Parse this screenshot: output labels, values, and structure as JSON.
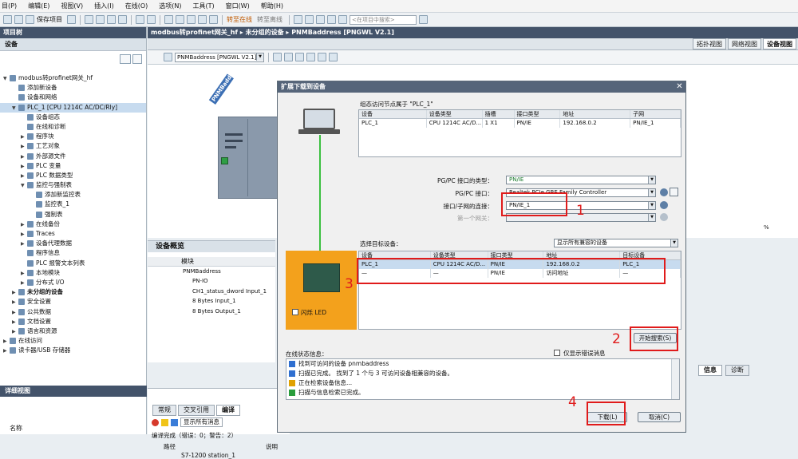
{
  "menu": [
    "目(P)",
    "编辑(E)",
    "视图(V)",
    "插入(I)",
    "在线(O)",
    "选项(N)",
    "工具(T)",
    "窗口(W)",
    "帮助(H)"
  ],
  "toolbar": {
    "save_project": "保存项目",
    "go_online": "转至在线",
    "go_offline": "转至离线",
    "search_placeholder": "<在项目中搜索>"
  },
  "project_tree": {
    "title": "项目树",
    "tab": "设备",
    "items": [
      {
        "label": "modbus转profinet网关_hf",
        "level": 0,
        "tw": "▼"
      },
      {
        "label": "添加新设备",
        "level": 1,
        "tw": ""
      },
      {
        "label": "设备和网络",
        "level": 1,
        "tw": ""
      },
      {
        "label": "PLC_1 [CPU 1214C AC/DC/Rly]",
        "level": 1,
        "tw": "▼",
        "selected": true
      },
      {
        "label": "设备组态",
        "level": 2,
        "tw": ""
      },
      {
        "label": "在线和诊断",
        "level": 2,
        "tw": ""
      },
      {
        "label": "程序块",
        "level": 2,
        "tw": "▶"
      },
      {
        "label": "工艺对象",
        "level": 2,
        "tw": "▶"
      },
      {
        "label": "外部源文件",
        "level": 2,
        "tw": "▶"
      },
      {
        "label": "PLC 变量",
        "level": 2,
        "tw": "▶"
      },
      {
        "label": "PLC 数据类型",
        "level": 2,
        "tw": "▶"
      },
      {
        "label": "监控与强制表",
        "level": 2,
        "tw": "▼"
      },
      {
        "label": "添加新监控表",
        "level": 3,
        "tw": ""
      },
      {
        "label": "监控表_1",
        "level": 3,
        "tw": ""
      },
      {
        "label": "强制表",
        "level": 3,
        "tw": ""
      },
      {
        "label": "在线备份",
        "level": 2,
        "tw": "▶"
      },
      {
        "label": "Traces",
        "level": 2,
        "tw": "▶"
      },
      {
        "label": "设备代理数据",
        "level": 2,
        "tw": "▶"
      },
      {
        "label": "程序信息",
        "level": 2,
        "tw": ""
      },
      {
        "label": "PLC 报警文本列表",
        "level": 2,
        "tw": ""
      },
      {
        "label": "本地模块",
        "level": 2,
        "tw": "▶"
      },
      {
        "label": "分布式 I/O",
        "level": 2,
        "tw": "▶"
      },
      {
        "label": "未分组的设备",
        "level": 1,
        "tw": "▶",
        "bold": true
      },
      {
        "label": "安全设置",
        "level": 1,
        "tw": "▶"
      },
      {
        "label": "公共数据",
        "level": 1,
        "tw": "▶"
      },
      {
        "label": "文档设置",
        "level": 1,
        "tw": "▶"
      },
      {
        "label": "语言和资源",
        "level": 1,
        "tw": "▶"
      },
      {
        "label": "在线访问",
        "level": 0,
        "tw": "▶"
      },
      {
        "label": "读卡器/USB 存储器",
        "level": 0,
        "tw": "▶"
      }
    ],
    "detail_view": "详细视图",
    "detail_col": "名称"
  },
  "breadcrumb": [
    "modbus转profinet网关_hf",
    "未分组的设备",
    "PNMBaddress [PNGWL V2.1]"
  ],
  "view_tabs": [
    "拓扑视图",
    "网络视图",
    "设备视图"
  ],
  "device_combo": "PNMBaddress [PNGWL V2.1]",
  "device_label": "PNMBaddress",
  "zoom_value": "%",
  "device_overview": {
    "title": "设备概览",
    "col_module": "模块",
    "rows": [
      "PNMBaddress",
      "PN-IO",
      "CH1_status_dword Input_1",
      "8 Bytes Input_1",
      "8 Bytes Output_1"
    ]
  },
  "bottom_panel": {
    "tabs": [
      "常规",
      "交叉引用",
      "编译"
    ],
    "filter_label": "显示所有消息",
    "status": "编译完成（错误：0；警告：2）",
    "col_path": "路径",
    "col_desc": "说明",
    "row1": "S7-1200 station_1"
  },
  "info_tabs": [
    "信息",
    "诊断"
  ],
  "dialog": {
    "title": "扩展下载到设备",
    "node_label": "组态访问节点属于 \"PLC_1\"",
    "config_headers": [
      "设备",
      "设备类型",
      "插槽",
      "接口类型",
      "地址",
      "子网"
    ],
    "config_row": [
      "PLC_1",
      "CPU 1214C AC/D...",
      "1 X1",
      "PN/IE",
      "192.168.0.2",
      "PN/IE_1"
    ],
    "pgpc_type_label": "PG/PC 接口的类型：",
    "pgpc_type_value": "PN/IE",
    "pgpc_iface_label": "PG/PC 接口：",
    "pgpc_iface_value": "Realtek PCIe GBE Family Controller",
    "subnet_label": "接口/子网的连接：",
    "subnet_value": "PN/IE_1",
    "gateway_label": "第一个网关：",
    "target_label": "选择目标设备：",
    "target_filter": "显示所有兼容的设备",
    "target_headers": [
      "设备",
      "设备类型",
      "接口类型",
      "地址",
      "目标设备"
    ],
    "target_rows": [
      [
        "PLC_1",
        "CPU 1214C AC/D...",
        "PN/IE",
        "192.168.0.2",
        "PLC_1"
      ],
      [
        "—",
        "—",
        "PN/IE",
        "访问地址",
        "—"
      ]
    ],
    "flash_led": "闪烁 LED",
    "start_search": "开始搜索(S)",
    "status_label": "在线状态信息：",
    "errors_only": "仅显示错误消息",
    "messages": [
      {
        "icon": "info",
        "text": "找到可访问的设备 pnmbaddress"
      },
      {
        "icon": "info",
        "text": "扫描已完成。 找到了 1 个与 3 可访问设备相兼容的设备。"
      },
      {
        "icon": "spinner",
        "text": "正在检索设备信息..."
      },
      {
        "icon": "check",
        "text": "扫描与信息检索已完成。"
      }
    ],
    "download_btn": "下载(L)",
    "cancel_btn": "取消(C)"
  },
  "annotations": [
    "1",
    "2",
    "3",
    "4"
  ]
}
